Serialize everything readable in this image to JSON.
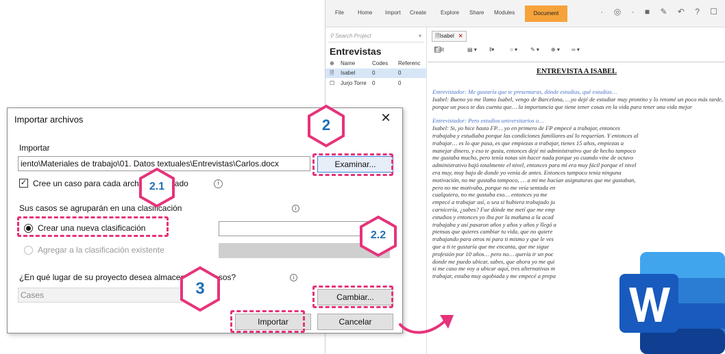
{
  "nvivo": {
    "ribbon_tabs": [
      "File",
      "Home",
      "Import",
      "Create",
      "Explore",
      "Share",
      "Modules",
      "Document"
    ],
    "search_placeholder": "Search Project",
    "folder_title": "Entrevistas",
    "columns": {
      "name": "Name",
      "codes": "Codes",
      "references": "Referenc"
    },
    "rows": [
      {
        "name": "Isabel",
        "codes": "0",
        "references": "0"
      },
      {
        "name": "Jurjo Torre",
        "codes": "0",
        "references": "0"
      }
    ],
    "doc_tab": "Isabel",
    "doc_tab_close": "✕",
    "edit_label": "Edit",
    "doc_title": "ENTREVISTA A ISABEL",
    "q1": "Entrevistador: Me gustaría que te presentaras, dónde estudias, qué estudias…",
    "a1": "Isabel: Bueno yo me llamo Isabel, vengo de Barcelona, …yo dejé de estudiar muy prontito y lo retomé un poco más tarde, porque un poco te das cuenta que… la importancia que tiene tener cosas en la vida para tener una vida mejor",
    "q2": "Entrevistador: Pero estudios universitarios o…",
    "a2_lines": [
      "Isabel: Si, yo hice hasta FP… yo en primero de FP empecé a trabajar, entonces",
      "trabajaba y estudiaba porque las condiciones familiares así lo requerían. Y entonces al",
      "trabajar… es lo que pasa, es que empiezas a trabajar, tienes 15 años, empiezas a",
      "manejar dinero, y eso te gusta, entonces dejé mi administrativo que de hecho tampoco",
      "me gustaba mucho, pero tenía notas sin hacer nada porque yo cuando vine de octavo",
      "administrativo bajó totalmente el nivel, entonces para mí era muy fácil porque el nivel",
      "era muy, muy bajo de donde yo venía de antes. Entonces tampoco tenía ninguna",
      "motivación, no me gustaba tampoco, … a mí me hacían asignaturas que me gustaban,",
      "pero no me motivaba, porque no me veía sentada en",
      "cualquiera, no me gustaba eso… entonces ya me",
      "empecé a trabajar así, o sea si hubiera trabajado ju",
      "carnicería, ¿sabes? Fue dónde me metí que me emp",
      "estudios y entonces yo iba por la mañana a la acad",
      "trabajaba y así pasaron años y años y años y llegó a",
      "piensas que quieres cambiar tu vida, que no quiere",
      "trabajando para otros ni para ti mismo y que le ves",
      "que a ti te gustaría que me encanta, que me sigue",
      "profesión por 10 años… pero no… quería ir un poc",
      "donde me puedo ubicar, sabes, que ahora yo me qui",
      "si me caso me voy a ubicar aquí, tres alternativas m",
      "trabajar, estaba muy agobiada y me empecé a prepa"
    ]
  },
  "dialog": {
    "title": "Importar archivos",
    "close_glyph": "✕",
    "import_label": "Importar",
    "file_path": "iento\\Materiales de trabajo\\01. Datos textuales\\Entrevistas\\Carlos.docx",
    "browse_button": "Examinar...",
    "create_case_label": "Cree un caso para cada archivo importado",
    "create_case_checked": true,
    "group_label": "Sus casos se agruparán en una clasificación",
    "radio_new": "Crear una nueva clasificación",
    "radio_existing": "Agregar a la clasificación existente",
    "location_label": "¿En qué lugar de su proyecto desea almacenar sus casos?",
    "location_value": "Cases",
    "change_button": "Cambiar...",
    "import_button": "Importar",
    "cancel_button": "Cancelar"
  },
  "annotations": {
    "step_2": "2",
    "step_2_1": "2.1",
    "step_2_2": "2.2",
    "step_3": "3"
  },
  "colors": {
    "annotation_pink": "#e6337a",
    "annotation_blue": "#1f6fb5",
    "nvivo_document_tab": "#f5a33a",
    "selected_row": "#d6e6f7",
    "interviewer_text": "#4a74c6"
  },
  "icons": [
    "search-icon",
    "document-icon",
    "case-icon",
    "info-icon",
    "close-icon",
    "word-logo-icon",
    "arrow-icon"
  ]
}
